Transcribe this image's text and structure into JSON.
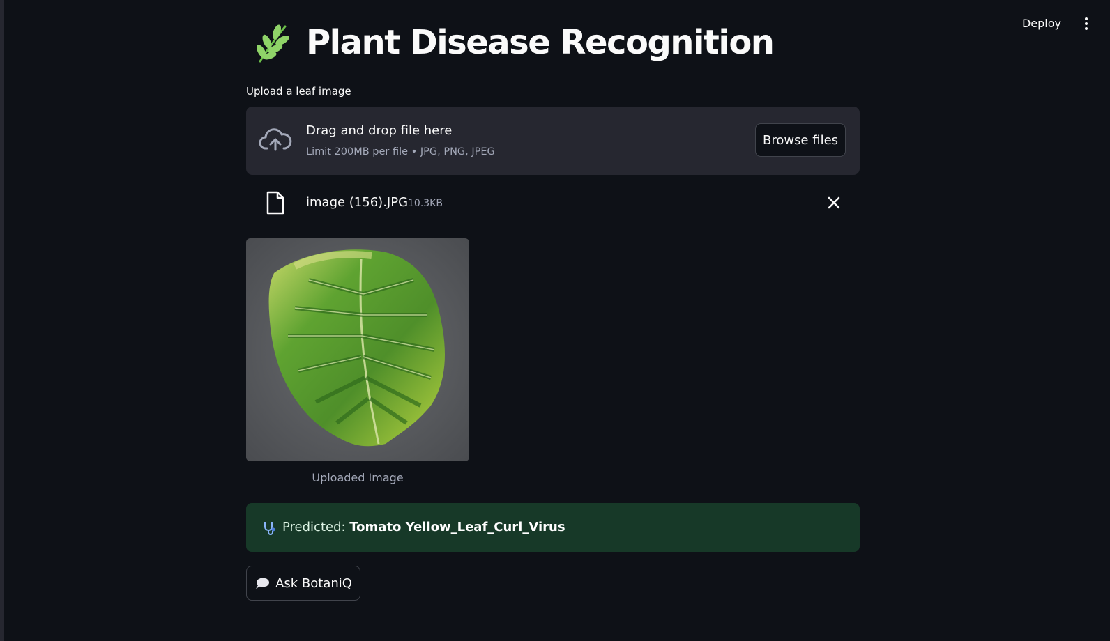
{
  "header": {
    "deploy_label": "Deploy",
    "menu_icon": "kebab-menu-icon"
  },
  "page": {
    "title": "Plant Disease Recognition",
    "title_icon": "herb-icon"
  },
  "uploader": {
    "label": "Upload a leaf image",
    "drop_title": "Drag and drop file here",
    "drop_subtitle": "Limit 200MB per file • JPG, PNG, JPEG",
    "browse_label": "Browse files",
    "icon": "cloud-upload-icon"
  },
  "uploaded_file": {
    "name": "image (156).JPG",
    "size": "10.3KB",
    "icon": "file-icon"
  },
  "image": {
    "caption": "Uploaded Image"
  },
  "prediction": {
    "prefix": "Predicted: ",
    "value": "Tomato Yellow_Leaf_Curl_Virus",
    "icon": "stethoscope-icon",
    "color": "#173928"
  },
  "ask": {
    "label": "Ask BotaniQ",
    "icon": "speech-balloon-icon"
  }
}
